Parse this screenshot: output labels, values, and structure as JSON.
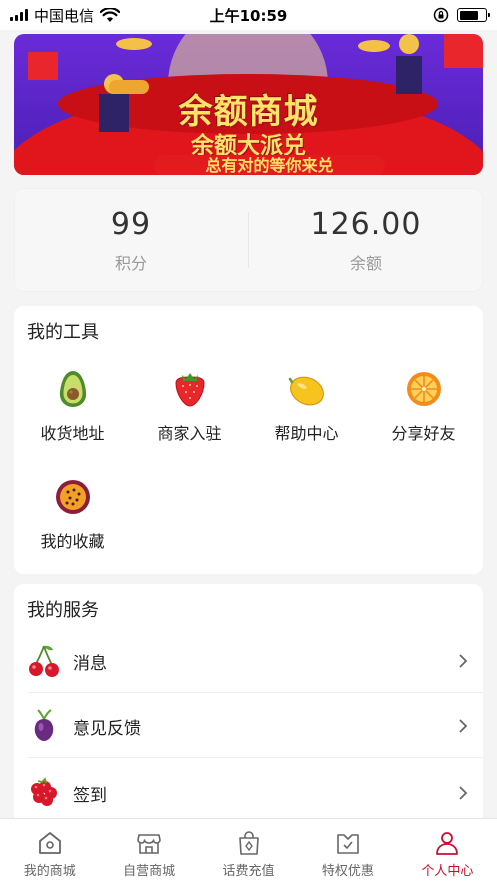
{
  "status_bar": {
    "carrier": "中国电信",
    "time": "上午10:59",
    "battery_level": 0.72
  },
  "banner": {
    "title": "余额商城",
    "subtitle": "余额大派兑",
    "tagline": "总有对的等你来兑"
  },
  "stats": {
    "points_value": "99",
    "points_label": "积分",
    "balance_value": "126.00",
    "balance_label": "余额"
  },
  "tools": {
    "title": "我的工具",
    "items": [
      {
        "label": "收货地址",
        "icon": "avocado-icon"
      },
      {
        "label": "商家入驻",
        "icon": "strawberry-icon"
      },
      {
        "label": "帮助中心",
        "icon": "lemon-icon"
      },
      {
        "label": "分享好友",
        "icon": "orange-icon"
      },
      {
        "label": "我的收藏",
        "icon": "passion-fruit-icon"
      }
    ]
  },
  "services": {
    "title": "我的服务",
    "items": [
      {
        "label": "消息",
        "icon": "cherry-icon"
      },
      {
        "label": "意见反馈",
        "icon": "beet-icon"
      },
      {
        "label": "签到",
        "icon": "raspberry-icon"
      }
    ]
  },
  "tabbar": {
    "items": [
      {
        "label": "我的商城",
        "icon": "home-icon"
      },
      {
        "label": "自营商城",
        "icon": "store-icon"
      },
      {
        "label": "话费充值",
        "icon": "shopping-bag-icon"
      },
      {
        "label": "特权优惠",
        "icon": "coupon-icon"
      },
      {
        "label": "个人中心",
        "icon": "person-icon"
      }
    ],
    "active_index": 4
  },
  "colors": {
    "accent": "#c8102e",
    "background": "#f4f4f4",
    "banner_purple": "#5a24c6",
    "banner_red": "#e11b1e",
    "banner_gold": "#ffe46a"
  }
}
